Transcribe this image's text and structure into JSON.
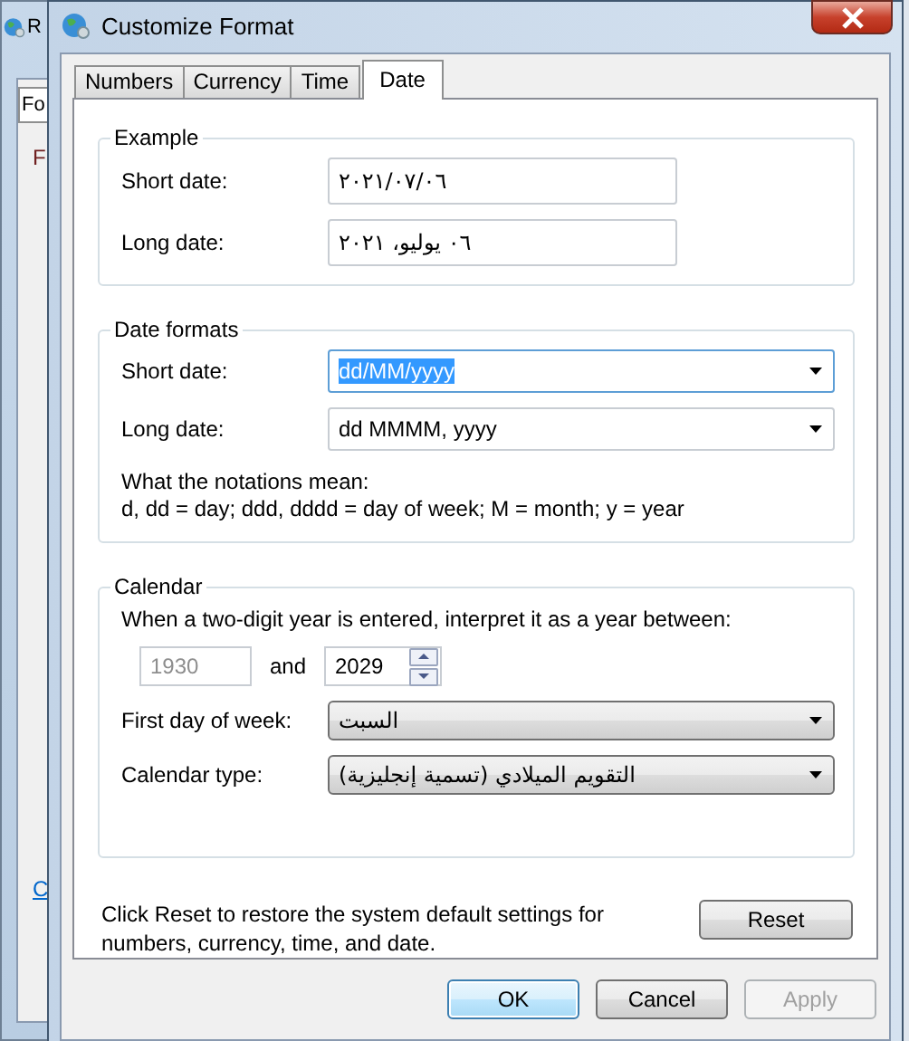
{
  "background_window": {
    "title": "R",
    "tab": "Fo",
    "label": "F",
    "link": "C"
  },
  "window": {
    "title": "Customize Format"
  },
  "tabs": [
    {
      "label": "Numbers",
      "selected": false
    },
    {
      "label": "Currency",
      "selected": false
    },
    {
      "label": "Time",
      "selected": false
    },
    {
      "label": "Date",
      "selected": true
    }
  ],
  "example": {
    "title": "Example",
    "fields": [
      {
        "label": "Short date:",
        "value": "٢٠٢١/٠٧/٠٦"
      },
      {
        "label": "Long date:",
        "value": "٠٦ يوليو، ٢٠٢١"
      }
    ]
  },
  "date_formats": {
    "title": "Date formats",
    "fields": [
      {
        "label": "Short date:",
        "value": "dd/MM/yyyy",
        "selected": true
      },
      {
        "label": "Long date:",
        "value": "dd MMMM, yyyy",
        "selected": false
      }
    ],
    "notes": [
      "What the notations mean:",
      "d, dd = day;  ddd, dddd = day of week;  M = month;  y = year"
    ]
  },
  "calendar": {
    "title": "Calendar",
    "prompt": "When a two-digit year is entered, interpret it as a year between:",
    "year_from": {
      "value": "1930",
      "disabled": true
    },
    "conjunction": "and",
    "year_to": {
      "value": "2029",
      "disabled": false
    },
    "selects": [
      {
        "label": "First day of week:",
        "value": "السبت"
      },
      {
        "label": "Calendar type:",
        "value": "التقويم الميلادي (تسمية إنجليزية)"
      }
    ]
  },
  "reset_note": "Click Reset to restore the system default settings for numbers, currency, time, and date.",
  "reset_button": "Reset",
  "buttons": [
    {
      "label": "OK",
      "kind": "default"
    },
    {
      "label": "Cancel",
      "kind": "normal"
    },
    {
      "label": "Apply",
      "kind": "disabled"
    }
  ]
}
